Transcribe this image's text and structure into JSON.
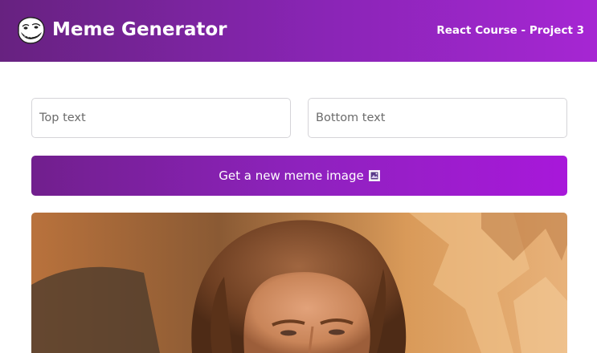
{
  "header": {
    "logo_icon": "troll-face-icon",
    "title": "Meme Generator",
    "subtitle": "React Course - Project 3"
  },
  "form": {
    "top_text": {
      "value": "",
      "placeholder": "Top text"
    },
    "bottom_text": {
      "value": "",
      "placeholder": "Bottom text"
    },
    "button_label": "Get a new meme image",
    "button_icon": "framed-picture-icon"
  },
  "meme": {
    "image_subject": "one-does-not-simply-meme-photo"
  },
  "colors": {
    "header_gradient_start": "#672280",
    "header_gradient_end": "#a626d3",
    "button_gradient_start": "#711f8d",
    "button_gradient_end": "#a818da"
  }
}
